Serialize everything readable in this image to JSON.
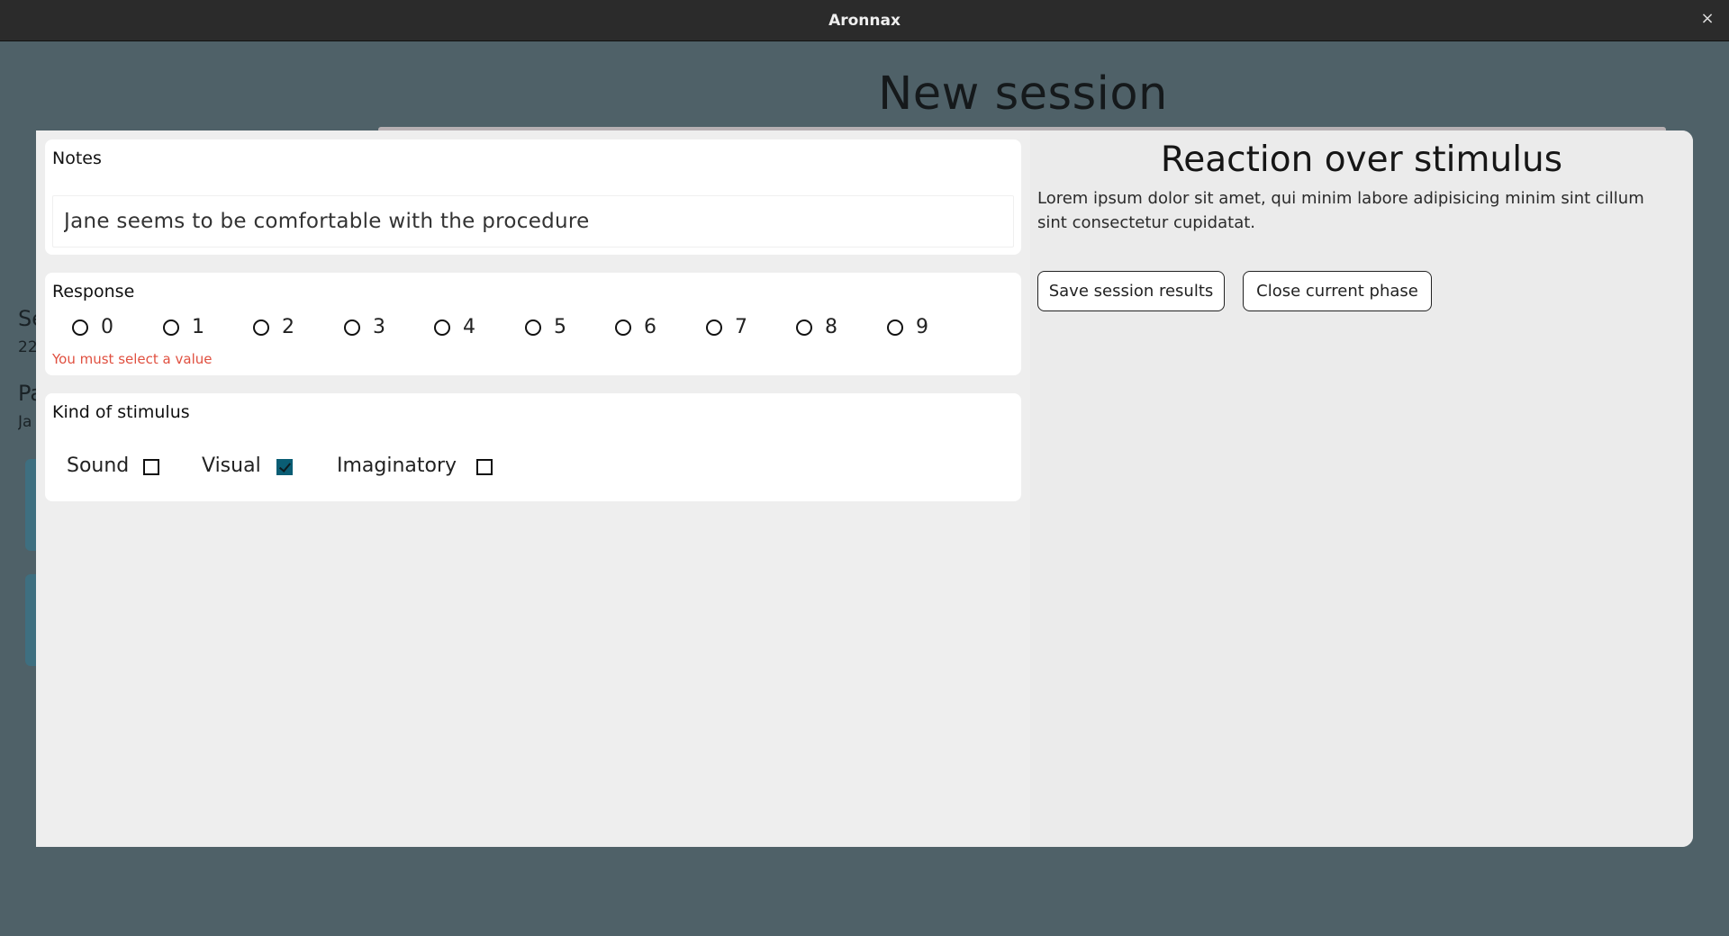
{
  "window": {
    "title": "Aronnax",
    "close_glyph": "×"
  },
  "page": {
    "heading": "New session"
  },
  "background": {
    "frag_label_1": "Se",
    "frag_value_1": "22",
    "frag_label_2": "Pa",
    "frag_value_2": "Ja"
  },
  "notes": {
    "label": "Notes",
    "value": "Jane seems to be comfortable with the procedure"
  },
  "response": {
    "label": "Response",
    "options": [
      "0",
      "1",
      "2",
      "3",
      "4",
      "5",
      "6",
      "7",
      "8",
      "9"
    ],
    "selected": null,
    "error": "You must select a value"
  },
  "stimulus": {
    "label": "Kind of stimulus",
    "options": [
      {
        "label": "Sound",
        "checked": false
      },
      {
        "label": "Visual",
        "checked": true
      },
      {
        "label": "Imaginatory",
        "checked": false
      }
    ]
  },
  "phase": {
    "title": "Reaction over stimulus",
    "description": "Lorem ipsum dolor sit amet, qui minim labore adipisicing minim sint cillum sint consectetur cupidatat.",
    "save_label": "Save session results",
    "close_label": "Close current phase"
  },
  "colors": {
    "backdrop": "#4f6168",
    "titlebar": "#2b2b2b",
    "accent": "#0a5d74",
    "error": "#e05040"
  }
}
